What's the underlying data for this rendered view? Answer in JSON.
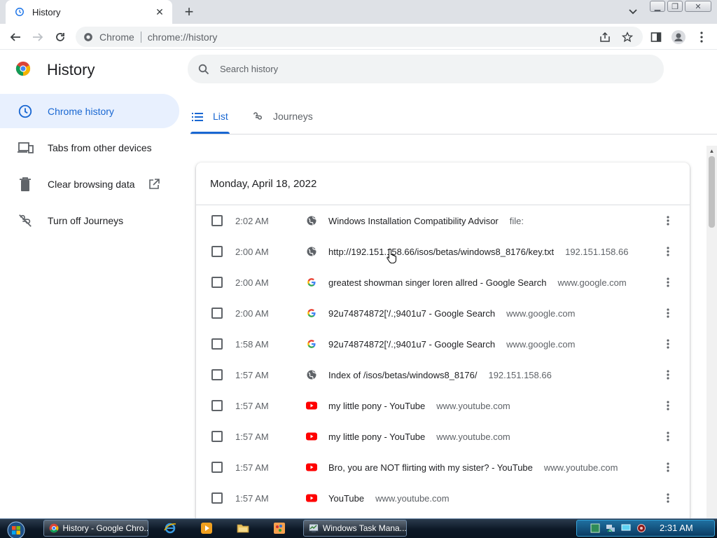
{
  "tab": {
    "title": "History"
  },
  "omnibox": {
    "chip": "Chrome",
    "url": "chrome://history"
  },
  "page": {
    "title": "History"
  },
  "search": {
    "placeholder": "Search history"
  },
  "sidebar": {
    "items": [
      {
        "label": "Chrome history",
        "icon": "clock-icon"
      },
      {
        "label": "Tabs from other devices",
        "icon": "devices-icon"
      },
      {
        "label": "Clear browsing data",
        "icon": "trash-icon"
      },
      {
        "label": "Turn off Journeys",
        "icon": "journeys-off-icon"
      }
    ]
  },
  "tabs": {
    "list": "List",
    "journeys": "Journeys"
  },
  "history": {
    "date": "Monday, April 18, 2022",
    "rows": [
      {
        "time": "2:02 AM",
        "favicon": "globe-icon",
        "title": "Windows Installation Compatibility Advisor",
        "domain": "file:"
      },
      {
        "time": "2:00 AM",
        "favicon": "globe-icon",
        "title": "http://192.151.158.66/isos/betas/windows8_8176/key.txt",
        "domain": "192.151.158.66"
      },
      {
        "time": "2:00 AM",
        "favicon": "google-icon",
        "title": "greatest showman singer loren allred - Google Search",
        "domain": "www.google.com"
      },
      {
        "time": "2:00 AM",
        "favicon": "google-icon",
        "title": "92u74874872['/.;9401u7 - Google Search",
        "domain": "www.google.com"
      },
      {
        "time": "1:58 AM",
        "favicon": "google-icon",
        "title": "92u74874872['/.;9401u7 - Google Search",
        "domain": "www.google.com"
      },
      {
        "time": "1:57 AM",
        "favicon": "globe-icon",
        "title": "Index of /isos/betas/windows8_8176/",
        "domain": "192.151.158.66"
      },
      {
        "time": "1:57 AM",
        "favicon": "youtube-icon",
        "title": "my little pony - YouTube",
        "domain": "www.youtube.com"
      },
      {
        "time": "1:57 AM",
        "favicon": "youtube-icon",
        "title": "my little pony - YouTube",
        "domain": "www.youtube.com"
      },
      {
        "time": "1:57 AM",
        "favicon": "youtube-icon",
        "title": "Bro, you are NOT flirting with my sister? - YouTube",
        "domain": "www.youtube.com"
      },
      {
        "time": "1:57 AM",
        "favicon": "youtube-icon",
        "title": "YouTube",
        "domain": "www.youtube.com"
      }
    ]
  },
  "taskbar": {
    "buttons": [
      {
        "label": "History - Google Chro...",
        "icon": "chrome-icon"
      },
      {
        "label": "Windows Task Mana...",
        "icon": "task-manager-icon"
      }
    ],
    "clock": "2:31 AM"
  },
  "colors": {
    "accent": "#1967d2",
    "active_bg": "#e8f0fe",
    "youtube": "#ff0000"
  }
}
